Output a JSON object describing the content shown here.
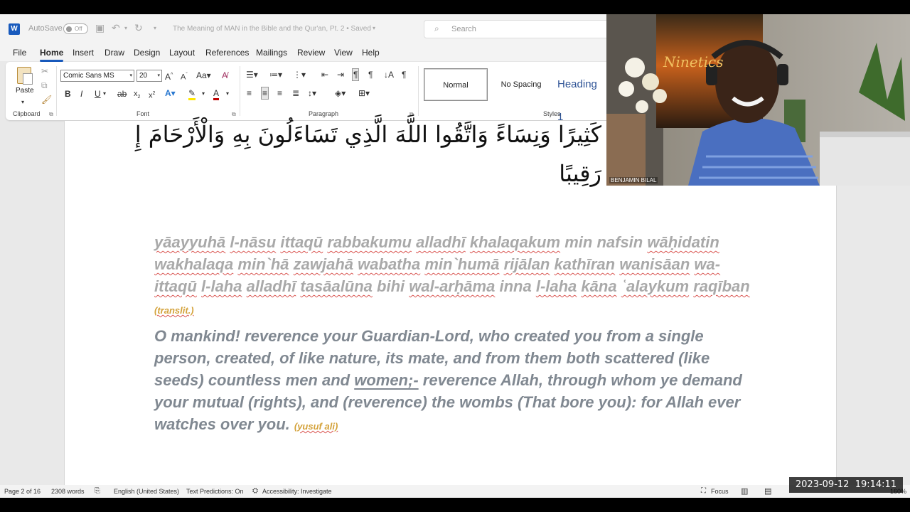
{
  "titlebar": {
    "autosave_label": "AutoSave",
    "autosave_state": "Off",
    "doc_title": "The Meaning of MAN in the Bible and the Qur'an, Pt. 2 • Saved",
    "search_placeholder": "Search"
  },
  "menu": {
    "tabs": [
      "File",
      "Home",
      "Insert",
      "Draw",
      "Design",
      "Layout",
      "References",
      "Mailings",
      "Review",
      "View",
      "Help"
    ]
  },
  "ribbon": {
    "paste_label": "Paste",
    "font_name": "Comic Sans MS",
    "font_size": "20",
    "groups": {
      "clipboard": "Clipboard",
      "font": "Font",
      "paragraph": "Paragraph",
      "styles": "Styles"
    },
    "styles": [
      "Normal",
      "No Spacing",
      "Heading 1"
    ]
  },
  "document": {
    "arabic_line1": "كَثِيرًا وَنِسَاءً وَاتَّقُوا اللَّهَ الَّذِي تَسَاءَلُونَ بِهِ وَالْأَرْحَامَ إِ",
    "arabic_line2": "رَقِيبًا",
    "translit_words": [
      "yāayyuhā",
      "l-nāsu",
      "ittaqū",
      "rabbakumu",
      "alladhī",
      "khalaqakum",
      "min",
      "nafsin",
      "wāḥidatin",
      "wakhalaqa",
      "min`hā",
      "zawjahā",
      "wabatha",
      "min`humā",
      "rijālan",
      "kathīran",
      "wanisāan",
      "wa-ittaqū",
      "l-laha",
      "alladhī",
      "tasāalūna",
      "bihi",
      "wal-arḥāma",
      "inna",
      "l-laha",
      "kāna",
      "ʿalaykum",
      "raqīban"
    ],
    "translit_tag": "(translit.)",
    "translation_before": "O mankind! reverence your Guardian-Lord, who created you from a single person, created, of like nature, its mate, and from them both scattered (like seeds) countless men and ",
    "translation_underlined": "women;-",
    "translation_after": " reverence Allah, through whom ye demand your mutual (rights), and (reverence) the wombs (That bore you): for Allah ever watches over you.",
    "translation_tag": "(yusuf ali)"
  },
  "statusbar": {
    "page": "Page 2 of 16",
    "words": "2308 words",
    "language": "English (United States)",
    "text_predictions": "Text Predictions: On",
    "accessibility": "Accessibility: Investigate",
    "focus": "Focus",
    "zoom": "160%"
  },
  "webcam": {
    "participant_name": "BENJAMIN BILAL",
    "poster_title": "Ninetics"
  },
  "timestamp": "2023-09-12  19:14:11"
}
